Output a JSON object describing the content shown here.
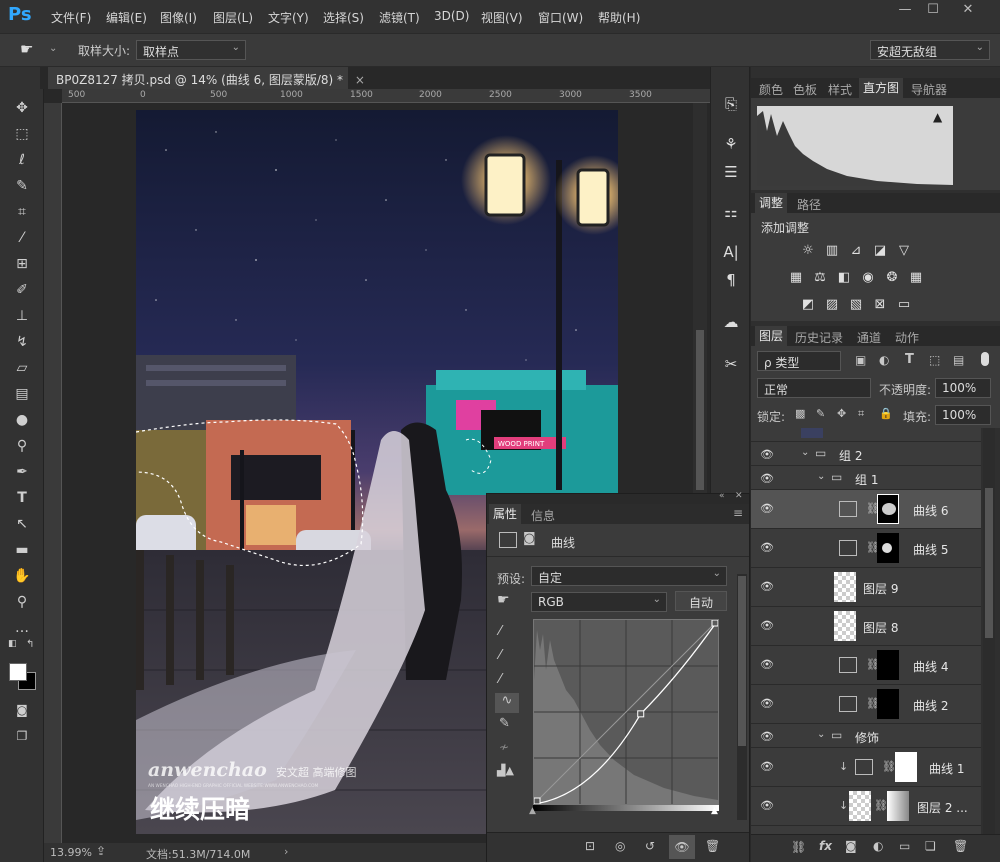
{
  "app": {
    "logo": "Ps",
    "doc_tab": "BP0Z8127 拷贝.psd @ 14% (曲线 6, 图层蒙版/8) *",
    "tab_close": "×"
  },
  "menu": [
    "文件(F)",
    "编辑(E)",
    "图像(I)",
    "图层(L)",
    "文字(Y)",
    "选择(S)",
    "滤镜(T)",
    "3D(D)",
    "视图(V)",
    "窗口(W)",
    "帮助(H)"
  ],
  "window_controls": {
    "minimize": "—",
    "maximize": "☐",
    "close": "✕"
  },
  "options": {
    "sample_size_label": "取样大小:",
    "sample_size_value": "取样点",
    "workspace": "安超无敌组"
  },
  "ruler_ticks": [
    "500",
    "0",
    "500",
    "1000",
    "1500",
    "2000",
    "2500",
    "3000",
    "3500"
  ],
  "status": {
    "zoom": "13.99%",
    "doc": "文档:51.3M/714.0M"
  },
  "photo": {
    "watermark_main": "anwenchao",
    "watermark_cn": "安文超 高端修图",
    "watermark_sub": "AN WENCHAO HIGH-END GRAPHIC OFFICIAL WEBSITE:WWW.ANWENCHAO.COM",
    "caption": "继续压暗",
    "sign": "WOOD PRINT"
  },
  "top_panel": {
    "tabs": [
      "颜色",
      "色板",
      "样式",
      "直方图",
      "导航器"
    ],
    "active": "直方图"
  },
  "adjust_panel": {
    "tabs": [
      "调整",
      "路径"
    ],
    "title": "添加调整"
  },
  "layers_panel": {
    "tabs": [
      "图层",
      "历史记录",
      "通道",
      "动作"
    ],
    "filter": "ρ 类型",
    "blend_mode": "正常",
    "opacity_label": "不透明度:",
    "opacity": "100%",
    "lock_label": "锁定:",
    "fill_label": "填充:",
    "fill": "100%",
    "layers": [
      {
        "name": "组 2",
        "kind": "group"
      },
      {
        "name": "组 1",
        "kind": "group"
      },
      {
        "name": "曲线 6",
        "kind": "curves",
        "selected": true
      },
      {
        "name": "曲线 5",
        "kind": "curves"
      },
      {
        "name": "图层 9",
        "kind": "pixel"
      },
      {
        "name": "图层 8",
        "kind": "pixel"
      },
      {
        "name": "曲线 4",
        "kind": "curves"
      },
      {
        "name": "曲线 2",
        "kind": "curves"
      },
      {
        "name": "修饰",
        "kind": "group"
      },
      {
        "name": "曲线 1",
        "kind": "curves"
      },
      {
        "name": "图层 2 ...",
        "kind": "pixel"
      }
    ]
  },
  "properties": {
    "tabs": [
      "属性",
      "信息"
    ],
    "title": "曲线",
    "preset_label": "预设:",
    "preset_value": "自定",
    "channel": "RGB",
    "auto_button": "自动",
    "curve_points": [
      [
        0,
        0
      ],
      [
        0.58,
        0.49
      ],
      [
        1,
        1
      ]
    ]
  }
}
